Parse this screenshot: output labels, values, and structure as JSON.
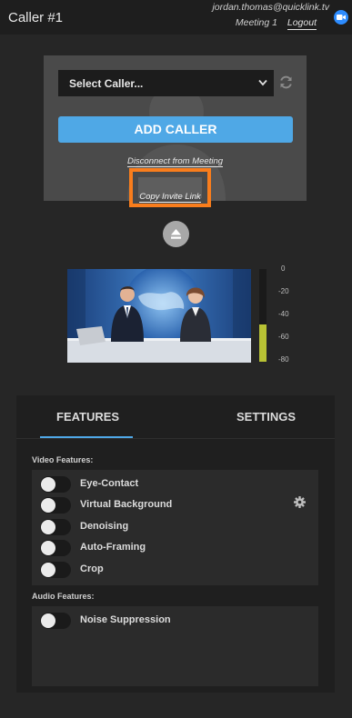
{
  "header": {
    "title": "Caller #1",
    "user_email": "jordan.thomas@quicklink.tv",
    "meeting_label": "Meeting 1",
    "logout_label": "Logout",
    "video_icon": "video-camera-icon"
  },
  "caller_panel": {
    "select_value": "Select Caller...",
    "refresh_icon": "refresh-icon",
    "add_caller_label": "ADD CALLER",
    "disconnect_label": "Disconnect from Meeting",
    "copy_invite_label": "Copy Invite Link",
    "highlight_color": "#f97d1c",
    "eject_icon": "eject-icon"
  },
  "preview": {
    "description_icon": "video-preview",
    "meter_level": 0.4,
    "meter_ticks": [
      "0",
      "-20",
      "-40",
      "-60",
      "-80"
    ],
    "meter_color": "#b8c234"
  },
  "tabs": [
    {
      "label": "FEATURES",
      "active": true
    },
    {
      "label": "SETTINGS",
      "active": false
    }
  ],
  "accent_color": "#4fa8e6",
  "video_features": {
    "title": "Video Features:",
    "items": [
      {
        "label": "Eye-Contact",
        "enabled": false
      },
      {
        "label": "Virtual Background",
        "enabled": false
      },
      {
        "label": "Denoising",
        "enabled": false
      },
      {
        "label": "Auto-Framing",
        "enabled": false
      },
      {
        "label": "Crop",
        "enabled": false
      }
    ],
    "settings_icon": "gear-icon"
  },
  "audio_features": {
    "title": "Audio Features:",
    "items": [
      {
        "label": "Noise Suppression",
        "enabled": false
      }
    ]
  }
}
